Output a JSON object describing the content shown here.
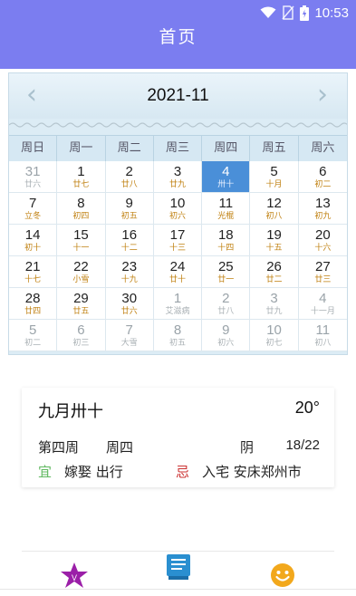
{
  "status_bar": {
    "time": "10:53",
    "icons": [
      "wifi-icon",
      "no-sim-icon",
      "battery-icon"
    ]
  },
  "app": {
    "title": "首页"
  },
  "calendar": {
    "month": "2021-11",
    "prev_icon": "chevron-left-icon",
    "next_icon": "chevron-right-icon",
    "weekdays": [
      "周日",
      "周一",
      "周二",
      "周三",
      "周四",
      "周五",
      "周六"
    ],
    "days": [
      {
        "d": "31",
        "l": "廿六",
        "dim": true
      },
      {
        "d": "1",
        "l": "廿七"
      },
      {
        "d": "2",
        "l": "廿八"
      },
      {
        "d": "3",
        "l": "廿九"
      },
      {
        "d": "4",
        "l": "卅十",
        "today": true
      },
      {
        "d": "5",
        "l": "十月"
      },
      {
        "d": "6",
        "l": "初二"
      },
      {
        "d": "7",
        "l": "立冬"
      },
      {
        "d": "8",
        "l": "初四"
      },
      {
        "d": "9",
        "l": "初五"
      },
      {
        "d": "10",
        "l": "初六"
      },
      {
        "d": "11",
        "l": "光棍"
      },
      {
        "d": "12",
        "l": "初八"
      },
      {
        "d": "13",
        "l": "初九"
      },
      {
        "d": "14",
        "l": "初十"
      },
      {
        "d": "15",
        "l": "十一"
      },
      {
        "d": "16",
        "l": "十二"
      },
      {
        "d": "17",
        "l": "十三"
      },
      {
        "d": "18",
        "l": "十四"
      },
      {
        "d": "19",
        "l": "十五"
      },
      {
        "d": "20",
        "l": "十六"
      },
      {
        "d": "21",
        "l": "十七"
      },
      {
        "d": "22",
        "l": "小雪"
      },
      {
        "d": "23",
        "l": "十九"
      },
      {
        "d": "24",
        "l": "廿十"
      },
      {
        "d": "25",
        "l": "廿一"
      },
      {
        "d": "26",
        "l": "廿二"
      },
      {
        "d": "27",
        "l": "廿三"
      },
      {
        "d": "28",
        "l": "廿四"
      },
      {
        "d": "29",
        "l": "廿五"
      },
      {
        "d": "30",
        "l": "廿六"
      },
      {
        "d": "1",
        "l": "艾滋病",
        "dim": true
      },
      {
        "d": "2",
        "l": "廿八",
        "dim": true
      },
      {
        "d": "3",
        "l": "廿九",
        "dim": true
      },
      {
        "d": "4",
        "l": "十一月",
        "dim": true
      },
      {
        "d": "5",
        "l": "初二",
        "dim": true
      },
      {
        "d": "6",
        "l": "初三",
        "dim": true
      },
      {
        "d": "7",
        "l": "大雪",
        "dim": true
      },
      {
        "d": "8",
        "l": "初五",
        "dim": true
      },
      {
        "d": "9",
        "l": "初六",
        "dim": true
      },
      {
        "d": "10",
        "l": "初七",
        "dim": true
      },
      {
        "d": "11",
        "l": "初八",
        "dim": true
      }
    ]
  },
  "info": {
    "lunar_date": "九月卅十",
    "temperature": "20°",
    "week_number": "第四周",
    "weekday": "周四",
    "weather": "阴",
    "temp_range": "18/22",
    "yi_mark": "宜",
    "yi": "嫁娶 出行",
    "ji_mark": "忌",
    "ji": "入宅 安床郑州市"
  },
  "tabs": [
    {
      "icon": "star-icon",
      "color": "#9b1fa8"
    },
    {
      "icon": "book-icon",
      "color": "#2a8fd0"
    },
    {
      "icon": "smiley-icon",
      "color": "#f2a81c"
    }
  ]
}
